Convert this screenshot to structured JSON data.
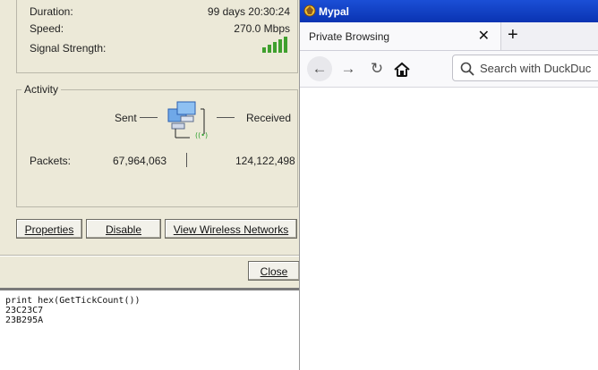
{
  "status_dialog": {
    "duration_label": "Duration:",
    "duration_value": "99 days 20:30:24",
    "speed_label": "Speed:",
    "speed_value": "270.0 Mbps",
    "signal_label": "Signal Strength:",
    "signal_bars": 5,
    "activity_title": "Activity",
    "sent_label": "Sent",
    "received_label": "Received",
    "packets_label": "Packets:",
    "packets_sent": "67,964,063",
    "packets_received": "124,122,498",
    "buttons": {
      "properties": "Properties",
      "disable": "Disable",
      "view_networks": "View Wireless Networks",
      "close": "Close"
    }
  },
  "console": {
    "lines": [
      "print hex(GetTickCount())",
      "23C23C7",
      "23B295A"
    ]
  },
  "browser": {
    "window_title": "Mypal",
    "tab_label": "Private Browsing",
    "search_placeholder": "Search with DuckDuc",
    "accent_color": "#0a33b2"
  }
}
